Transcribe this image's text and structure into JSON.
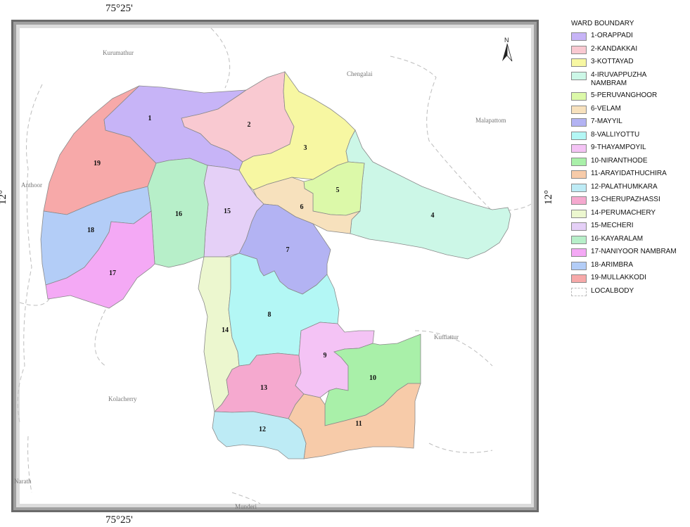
{
  "coordinates": {
    "top": "75°25'",
    "bottom": "75°25'",
    "left": "12°",
    "right": "12°"
  },
  "north_arrow": {
    "label": "N",
    "icon": "north-arrow-icon"
  },
  "place_names": {
    "kurumathur": "Kurumathur",
    "chengalai": "Chengalai",
    "malapattom": "Malapattom",
    "anthoor": "Anthoor",
    "kuttiattur": "Kuttiattur",
    "kolacherry": "Kolacherry",
    "narath": "Narath",
    "munderi": "Munderi"
  },
  "wards": [
    {
      "number": "1",
      "color": "#c7b4f7"
    },
    {
      "number": "2",
      "color": "#f9c9d1"
    },
    {
      "number": "3",
      "color": "#f7f7a2"
    },
    {
      "number": "4",
      "color": "#ccf7e7"
    },
    {
      "number": "5",
      "color": "#dcf9a9"
    },
    {
      "number": "6",
      "color": "#f7e1bd"
    },
    {
      "number": "7",
      "color": "#b3b3f3"
    },
    {
      "number": "8",
      "color": "#b3f7f5"
    },
    {
      "number": "9",
      "color": "#f4c3f5"
    },
    {
      "number": "10",
      "color": "#a9f0a9"
    },
    {
      "number": "11",
      "color": "#f7cba9"
    },
    {
      "number": "12",
      "color": "#bdebf5"
    },
    {
      "number": "13",
      "color": "#f5a9cf"
    },
    {
      "number": "14",
      "color": "#ecf7cf"
    },
    {
      "number": "15",
      "color": "#e5d0f7"
    },
    {
      "number": "16",
      "color": "#b7efc9"
    },
    {
      "number": "17",
      "color": "#f4a9f5"
    },
    {
      "number": "18",
      "color": "#b3cdf7"
    },
    {
      "number": "19",
      "color": "#f7a9a9"
    }
  ],
  "legend": {
    "title": "WARD BOUNDARY",
    "items": [
      {
        "label": "1-ORAPPADI",
        "color": "#c7b4f7"
      },
      {
        "label": "2-KANDAKKAI",
        "color": "#f9c9d1"
      },
      {
        "label": "3-KOTTAYAD",
        "color": "#f7f7a2"
      },
      {
        "label": "4-IRUVAPPUZHA NAMBRAM",
        "color": "#ccf7e7"
      },
      {
        "label": "5-PERUVANGHOOR",
        "color": "#dcf9a9"
      },
      {
        "label": "6-VELAM",
        "color": "#f7e1bd"
      },
      {
        "label": "7-MAYYIL",
        "color": "#b3b3f3"
      },
      {
        "label": "8-VALLIYOTTU",
        "color": "#b3f7f5"
      },
      {
        "label": "9-THAYAMPOYIL",
        "color": "#f4c3f5"
      },
      {
        "label": "10-NIRANTHODE",
        "color": "#a9f0a9"
      },
      {
        "label": "11-ARAYIDATHUCHIRA",
        "color": "#f7cba9"
      },
      {
        "label": "12-PALATHUMKARA",
        "color": "#bdebf5"
      },
      {
        "label": "13-CHERUPAZHASSI",
        "color": "#f5a9cf"
      },
      {
        "label": "14-PERUMACHERY",
        "color": "#ecf7cf"
      },
      {
        "label": "15-MECHERI",
        "color": "#e5d0f7"
      },
      {
        "label": "16-KAYARALAM",
        "color": "#b7efc9"
      },
      {
        "label": "17-NANIYOOR NAMBRAM",
        "color": "#f4a9f5"
      },
      {
        "label": "18-ARIMBRA",
        "color": "#b3cdf7"
      },
      {
        "label": "19-MULLAKKODI",
        "color": "#f7a9a9"
      }
    ],
    "localbody": {
      "label": "LOCALBODY",
      "style": "dashed"
    }
  }
}
